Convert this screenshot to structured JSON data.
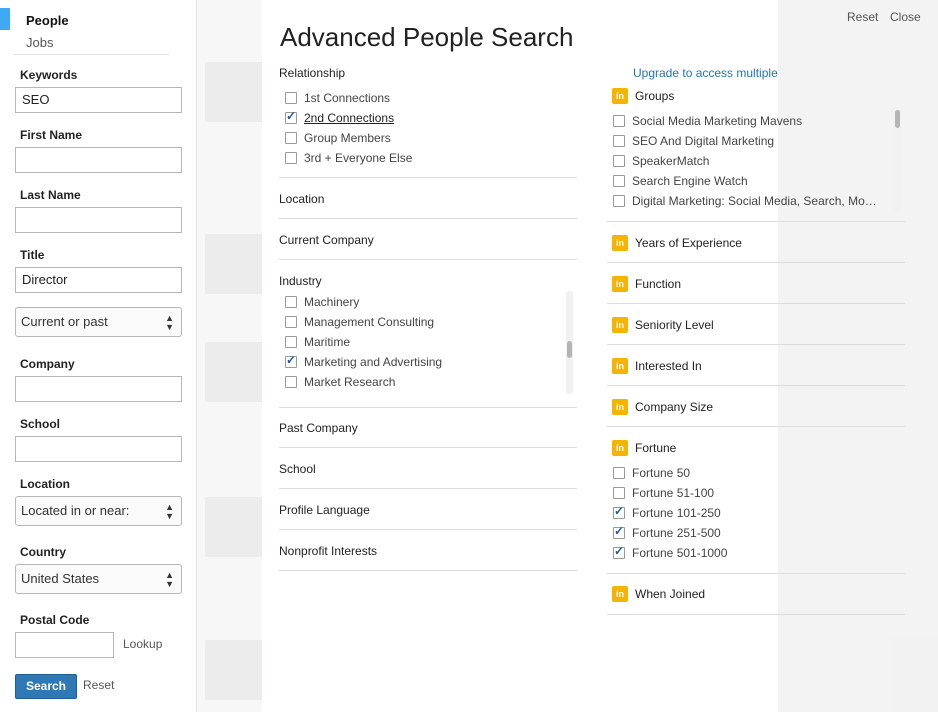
{
  "sidebar": {
    "tabs": [
      {
        "label": "People"
      },
      {
        "label": "Jobs"
      }
    ],
    "fields": {
      "keywords": {
        "label": "Keywords",
        "value": "SEO"
      },
      "first_name": {
        "label": "First Name",
        "value": ""
      },
      "last_name": {
        "label": "Last Name",
        "value": ""
      },
      "title": {
        "label": "Title",
        "value": "Director",
        "scope": "Current or past"
      },
      "company": {
        "label": "Company",
        "value": ""
      },
      "school": {
        "label": "School",
        "value": ""
      },
      "location": {
        "label": "Location",
        "value": "Located in or near:"
      },
      "country": {
        "label": "Country",
        "value": "United States"
      },
      "postal_code": {
        "label": "Postal Code",
        "value": "",
        "lookup": "Lookup"
      }
    },
    "search_button": "Search",
    "reset": "Reset"
  },
  "modal": {
    "title": "Advanced People Search",
    "reset": "Reset",
    "close": "Close",
    "relationship": {
      "label": "Relationship",
      "options": [
        {
          "label": "1st Connections",
          "checked": false
        },
        {
          "label": "2nd Connections",
          "checked": true
        },
        {
          "label": "Group Members",
          "checked": false
        },
        {
          "label": "3rd + Everyone Else",
          "checked": false
        }
      ]
    },
    "location_label": "Location",
    "current_company_label": "Current Company",
    "industry": {
      "label": "Industry",
      "options": [
        {
          "label": "Machinery",
          "checked": false
        },
        {
          "label": "Management Consulting",
          "checked": false
        },
        {
          "label": "Maritime",
          "checked": false
        },
        {
          "label": "Marketing and Advertising",
          "checked": true
        },
        {
          "label": "Market Research",
          "checked": false
        }
      ]
    },
    "past_company_label": "Past Company",
    "school_label": "School",
    "profile_language_label": "Profile Language",
    "nonprofit_label": "Nonprofit Interests",
    "upgrade_link": "Upgrade to access multiple",
    "badge": "in",
    "groups": {
      "label": "Groups",
      "options": [
        {
          "label": "Social Media Marketing Mavens",
          "checked": false
        },
        {
          "label": "SEO And Digital Marketing",
          "checked": false
        },
        {
          "label": "SpeakerMatch",
          "checked": false
        },
        {
          "label": "Search Engine Watch",
          "checked": false
        },
        {
          "label": "Digital Marketing: Social Media, Search, Mo…",
          "checked": false
        }
      ]
    },
    "years_experience_label": "Years of Experience",
    "function_label": "Function",
    "seniority_label": "Seniority Level",
    "interested_label": "Interested In",
    "company_size_label": "Company Size",
    "fortune": {
      "label": "Fortune",
      "options": [
        {
          "label": "Fortune 50",
          "checked": false
        },
        {
          "label": "Fortune 51-100",
          "checked": false
        },
        {
          "label": "Fortune 101-250",
          "checked": true
        },
        {
          "label": "Fortune 251-500",
          "checked": true
        },
        {
          "label": "Fortune 501-1000",
          "checked": true
        }
      ]
    },
    "when_joined_label": "When Joined"
  },
  "colors": {
    "accent": "#3fa9f5",
    "premium_badge": "#f5b400",
    "search_button": "#2e78b5",
    "link": "#2275b8"
  }
}
